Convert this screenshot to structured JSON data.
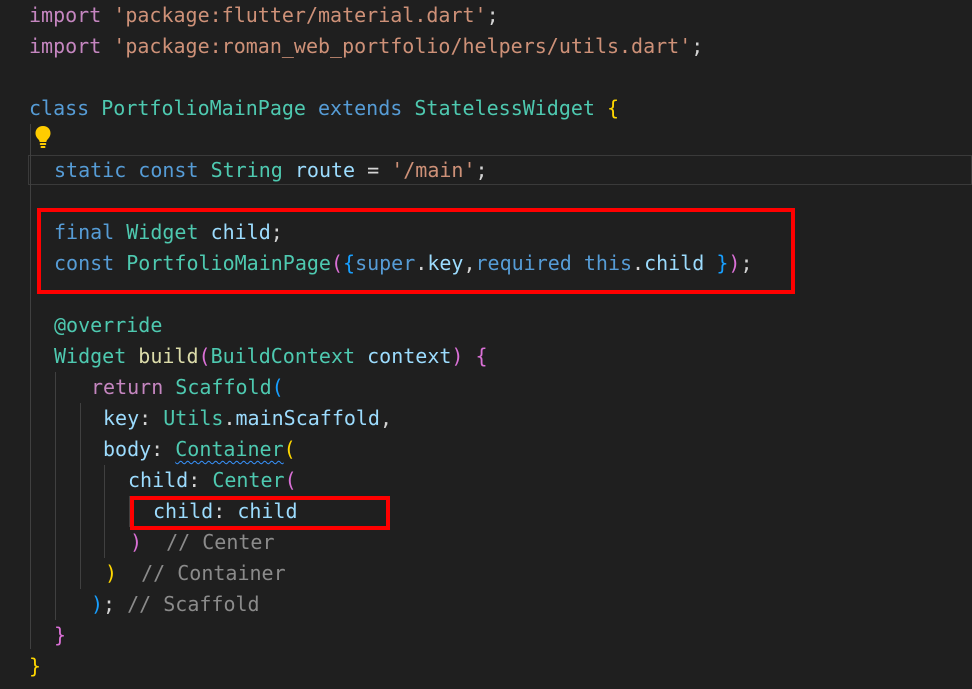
{
  "code": {
    "line1": {
      "kw": "import",
      "str": "'package:flutter/material.dart'",
      "end": ";"
    },
    "line2": {
      "kw": "import",
      "str": "'package:roman_web_portfolio/helpers/utils.dart'",
      "end": ";"
    },
    "line4": {
      "kw1": "class",
      "cls": "PortfolioMainPage",
      "kw2": "extends",
      "base": "StatelessWidget",
      "brace": "{"
    },
    "line6": {
      "kw1": "static",
      "kw2": "const",
      "type": "String",
      "name": "route",
      "eq": " = ",
      "str": "'/main'",
      "end": ";"
    },
    "line8": {
      "kw": "final",
      "type": "Widget",
      "name": "child",
      "end": ";"
    },
    "line9": {
      "kw": "const",
      "cls": "PortfolioMainPage",
      "p1": "(",
      "p2": "{",
      "sup": "super",
      "dot": ".",
      "key": "key",
      "comma": ",",
      "req": "required",
      "this": "this",
      "dot2": ".",
      "child": "child",
      "sp": " ",
      "p3": "}",
      "p4": ")",
      "end": ";"
    },
    "line11": {
      "ann": "@override"
    },
    "line12": {
      "type": "Widget",
      "fn": "build",
      "p1": "(",
      "ptype": "BuildContext",
      "pname": "context",
      "p2": ")",
      "brace": "{"
    },
    "line13": {
      "kw": "return",
      "cls": "Scaffold",
      "p": "("
    },
    "line14": {
      "prop": "key",
      "colon": ": ",
      "cls": "Utils",
      "dot": ".",
      "field": "mainScaffold",
      "comma": ","
    },
    "line15": {
      "prop": "body",
      "colon": ": ",
      "cls": "Container",
      "p": "("
    },
    "line16": {
      "prop": "child",
      "colon": ": ",
      "cls": "Center",
      "p": "("
    },
    "line17": {
      "prop": "child",
      "colon": ": ",
      "val": "child"
    },
    "line18": {
      "p": ")",
      "cm": "// Center"
    },
    "line19": {
      "p": ")",
      "cm": "// Container"
    },
    "line20": {
      "p": ")",
      "semi": ";",
      "cm": "// Scaffold"
    },
    "line21": {
      "brace": "}"
    },
    "line22": {
      "brace": "}"
    }
  },
  "colors": {
    "background": "#1f1f1f",
    "keyword": "#569cd6",
    "control": "#c586c0",
    "string": "#ce9178",
    "type": "#4ec9b0",
    "function": "#dcdcaa",
    "variable": "#9cdcfe",
    "comment": "#8b8b8b",
    "highlight": "#ff0000"
  },
  "icons": {
    "lightbulb": "lightbulb-icon"
  }
}
